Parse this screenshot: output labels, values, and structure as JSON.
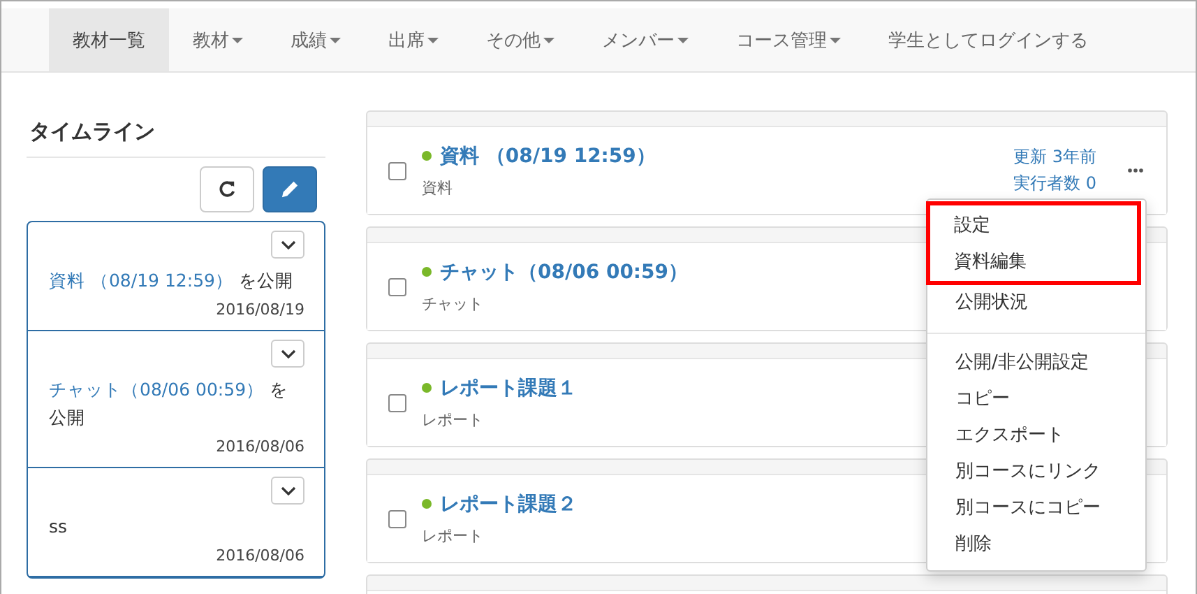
{
  "nav": [
    {
      "label": "教材一覧",
      "dropdown": false,
      "selected": true
    },
    {
      "label": "教材",
      "dropdown": true,
      "selected": false
    },
    {
      "label": "成績",
      "dropdown": true,
      "selected": false
    },
    {
      "label": "出席",
      "dropdown": true,
      "selected": false
    },
    {
      "label": "その他",
      "dropdown": true,
      "selected": false
    },
    {
      "label": "メンバー",
      "dropdown": true,
      "selected": false
    },
    {
      "label": "コース管理",
      "dropdown": true,
      "selected": false
    },
    {
      "label": "学生としてログインする",
      "dropdown": false,
      "selected": false
    }
  ],
  "timeline": {
    "title": "タイムライン",
    "entries": [
      {
        "link": "資料 （08/19 12:59）",
        "text": "を公開",
        "date": "2016/08/19"
      },
      {
        "link": "チャット（08/06 00:59）",
        "text": "を公開",
        "date": "2016/08/06"
      },
      {
        "text": "ss",
        "date": "2016/08/06"
      }
    ]
  },
  "materials": [
    {
      "title": "資料 （08/19 12:59）",
      "type": "資料",
      "published": true,
      "checked": false,
      "updated": "更新 3年前",
      "runners": "実行者数 0"
    },
    {
      "title": "チャット（08/06 00:59）",
      "type": "チャット",
      "published": true,
      "checked": false
    },
    {
      "title": "レポート課題１",
      "type": "レポート",
      "published": true,
      "checked": false
    },
    {
      "title": "レポート課題２",
      "type": "レポート",
      "published": true,
      "checked": false
    }
  ],
  "menu": {
    "groups": [
      [
        {
          "label": "設定",
          "highlighted": true
        },
        {
          "label": "資料編集",
          "highlighted": true
        },
        {
          "label": "公開状況",
          "highlighted": false
        }
      ],
      [
        {
          "label": "公開/非公開設定",
          "highlighted": false
        },
        {
          "label": "コピー",
          "highlighted": false
        },
        {
          "label": "エクスポート",
          "highlighted": false
        },
        {
          "label": "別コースにリンク",
          "highlighted": false
        },
        {
          "label": "別コースにコピー",
          "highlighted": false
        },
        {
          "label": "削除",
          "highlighted": false
        }
      ]
    ]
  }
}
